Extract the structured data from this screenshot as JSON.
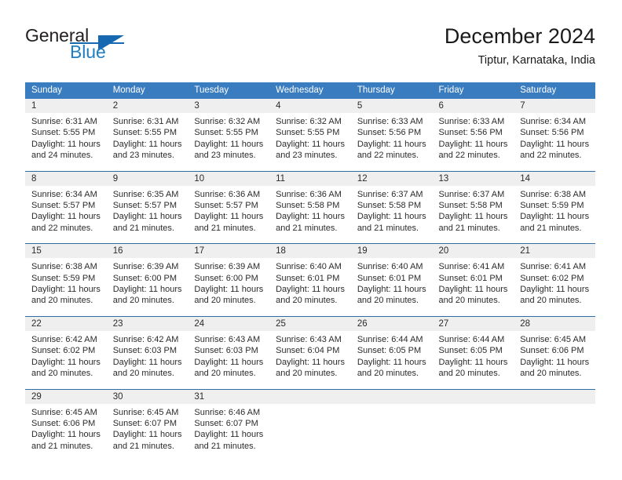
{
  "brand": {
    "word_one": "General",
    "word_two": "Blue",
    "triangle_icon": "brand-triangle-icon",
    "accent_color": "#1668b0",
    "text_color": "#231f20"
  },
  "header": {
    "title": "December 2024",
    "subtitle": "Tiptur, Karnataka, India"
  },
  "theme": {
    "header_row_bg": "#3a7cc0",
    "day_band_bg": "#efefef",
    "row_divider": "#2e6ca4",
    "body_text": "#2b2b2b"
  },
  "weekdays": [
    "Sunday",
    "Monday",
    "Tuesday",
    "Wednesday",
    "Thursday",
    "Friday",
    "Saturday"
  ],
  "weeks": [
    [
      {
        "day": "1",
        "sunrise": "Sunrise: 6:31 AM",
        "sunset": "Sunset: 5:55 PM",
        "daylight1": "Daylight: 11 hours",
        "daylight2": "and 24 minutes."
      },
      {
        "day": "2",
        "sunrise": "Sunrise: 6:31 AM",
        "sunset": "Sunset: 5:55 PM",
        "daylight1": "Daylight: 11 hours",
        "daylight2": "and 23 minutes."
      },
      {
        "day": "3",
        "sunrise": "Sunrise: 6:32 AM",
        "sunset": "Sunset: 5:55 PM",
        "daylight1": "Daylight: 11 hours",
        "daylight2": "and 23 minutes."
      },
      {
        "day": "4",
        "sunrise": "Sunrise: 6:32 AM",
        "sunset": "Sunset: 5:55 PM",
        "daylight1": "Daylight: 11 hours",
        "daylight2": "and 23 minutes."
      },
      {
        "day": "5",
        "sunrise": "Sunrise: 6:33 AM",
        "sunset": "Sunset: 5:56 PM",
        "daylight1": "Daylight: 11 hours",
        "daylight2": "and 22 minutes."
      },
      {
        "day": "6",
        "sunrise": "Sunrise: 6:33 AM",
        "sunset": "Sunset: 5:56 PM",
        "daylight1": "Daylight: 11 hours",
        "daylight2": "and 22 minutes."
      },
      {
        "day": "7",
        "sunrise": "Sunrise: 6:34 AM",
        "sunset": "Sunset: 5:56 PM",
        "daylight1": "Daylight: 11 hours",
        "daylight2": "and 22 minutes."
      }
    ],
    [
      {
        "day": "8",
        "sunrise": "Sunrise: 6:34 AM",
        "sunset": "Sunset: 5:57 PM",
        "daylight1": "Daylight: 11 hours",
        "daylight2": "and 22 minutes."
      },
      {
        "day": "9",
        "sunrise": "Sunrise: 6:35 AM",
        "sunset": "Sunset: 5:57 PM",
        "daylight1": "Daylight: 11 hours",
        "daylight2": "and 21 minutes."
      },
      {
        "day": "10",
        "sunrise": "Sunrise: 6:36 AM",
        "sunset": "Sunset: 5:57 PM",
        "daylight1": "Daylight: 11 hours",
        "daylight2": "and 21 minutes."
      },
      {
        "day": "11",
        "sunrise": "Sunrise: 6:36 AM",
        "sunset": "Sunset: 5:58 PM",
        "daylight1": "Daylight: 11 hours",
        "daylight2": "and 21 minutes."
      },
      {
        "day": "12",
        "sunrise": "Sunrise: 6:37 AM",
        "sunset": "Sunset: 5:58 PM",
        "daylight1": "Daylight: 11 hours",
        "daylight2": "and 21 minutes."
      },
      {
        "day": "13",
        "sunrise": "Sunrise: 6:37 AM",
        "sunset": "Sunset: 5:58 PM",
        "daylight1": "Daylight: 11 hours",
        "daylight2": "and 21 minutes."
      },
      {
        "day": "14",
        "sunrise": "Sunrise: 6:38 AM",
        "sunset": "Sunset: 5:59 PM",
        "daylight1": "Daylight: 11 hours",
        "daylight2": "and 21 minutes."
      }
    ],
    [
      {
        "day": "15",
        "sunrise": "Sunrise: 6:38 AM",
        "sunset": "Sunset: 5:59 PM",
        "daylight1": "Daylight: 11 hours",
        "daylight2": "and 20 minutes."
      },
      {
        "day": "16",
        "sunrise": "Sunrise: 6:39 AM",
        "sunset": "Sunset: 6:00 PM",
        "daylight1": "Daylight: 11 hours",
        "daylight2": "and 20 minutes."
      },
      {
        "day": "17",
        "sunrise": "Sunrise: 6:39 AM",
        "sunset": "Sunset: 6:00 PM",
        "daylight1": "Daylight: 11 hours",
        "daylight2": "and 20 minutes."
      },
      {
        "day": "18",
        "sunrise": "Sunrise: 6:40 AM",
        "sunset": "Sunset: 6:01 PM",
        "daylight1": "Daylight: 11 hours",
        "daylight2": "and 20 minutes."
      },
      {
        "day": "19",
        "sunrise": "Sunrise: 6:40 AM",
        "sunset": "Sunset: 6:01 PM",
        "daylight1": "Daylight: 11 hours",
        "daylight2": "and 20 minutes."
      },
      {
        "day": "20",
        "sunrise": "Sunrise: 6:41 AM",
        "sunset": "Sunset: 6:01 PM",
        "daylight1": "Daylight: 11 hours",
        "daylight2": "and 20 minutes."
      },
      {
        "day": "21",
        "sunrise": "Sunrise: 6:41 AM",
        "sunset": "Sunset: 6:02 PM",
        "daylight1": "Daylight: 11 hours",
        "daylight2": "and 20 minutes."
      }
    ],
    [
      {
        "day": "22",
        "sunrise": "Sunrise: 6:42 AM",
        "sunset": "Sunset: 6:02 PM",
        "daylight1": "Daylight: 11 hours",
        "daylight2": "and 20 minutes."
      },
      {
        "day": "23",
        "sunrise": "Sunrise: 6:42 AM",
        "sunset": "Sunset: 6:03 PM",
        "daylight1": "Daylight: 11 hours",
        "daylight2": "and 20 minutes."
      },
      {
        "day": "24",
        "sunrise": "Sunrise: 6:43 AM",
        "sunset": "Sunset: 6:03 PM",
        "daylight1": "Daylight: 11 hours",
        "daylight2": "and 20 minutes."
      },
      {
        "day": "25",
        "sunrise": "Sunrise: 6:43 AM",
        "sunset": "Sunset: 6:04 PM",
        "daylight1": "Daylight: 11 hours",
        "daylight2": "and 20 minutes."
      },
      {
        "day": "26",
        "sunrise": "Sunrise: 6:44 AM",
        "sunset": "Sunset: 6:05 PM",
        "daylight1": "Daylight: 11 hours",
        "daylight2": "and 20 minutes."
      },
      {
        "day": "27",
        "sunrise": "Sunrise: 6:44 AM",
        "sunset": "Sunset: 6:05 PM",
        "daylight1": "Daylight: 11 hours",
        "daylight2": "and 20 minutes."
      },
      {
        "day": "28",
        "sunrise": "Sunrise: 6:45 AM",
        "sunset": "Sunset: 6:06 PM",
        "daylight1": "Daylight: 11 hours",
        "daylight2": "and 20 minutes."
      }
    ],
    [
      {
        "day": "29",
        "sunrise": "Sunrise: 6:45 AM",
        "sunset": "Sunset: 6:06 PM",
        "daylight1": "Daylight: 11 hours",
        "daylight2": "and 21 minutes."
      },
      {
        "day": "30",
        "sunrise": "Sunrise: 6:45 AM",
        "sunset": "Sunset: 6:07 PM",
        "daylight1": "Daylight: 11 hours",
        "daylight2": "and 21 minutes."
      },
      {
        "day": "31",
        "sunrise": "Sunrise: 6:46 AM",
        "sunset": "Sunset: 6:07 PM",
        "daylight1": "Daylight: 11 hours",
        "daylight2": "and 21 minutes."
      },
      {
        "day": "",
        "sunrise": "",
        "sunset": "",
        "daylight1": "",
        "daylight2": ""
      },
      {
        "day": "",
        "sunrise": "",
        "sunset": "",
        "daylight1": "",
        "daylight2": ""
      },
      {
        "day": "",
        "sunrise": "",
        "sunset": "",
        "daylight1": "",
        "daylight2": ""
      },
      {
        "day": "",
        "sunrise": "",
        "sunset": "",
        "daylight1": "",
        "daylight2": ""
      }
    ]
  ]
}
